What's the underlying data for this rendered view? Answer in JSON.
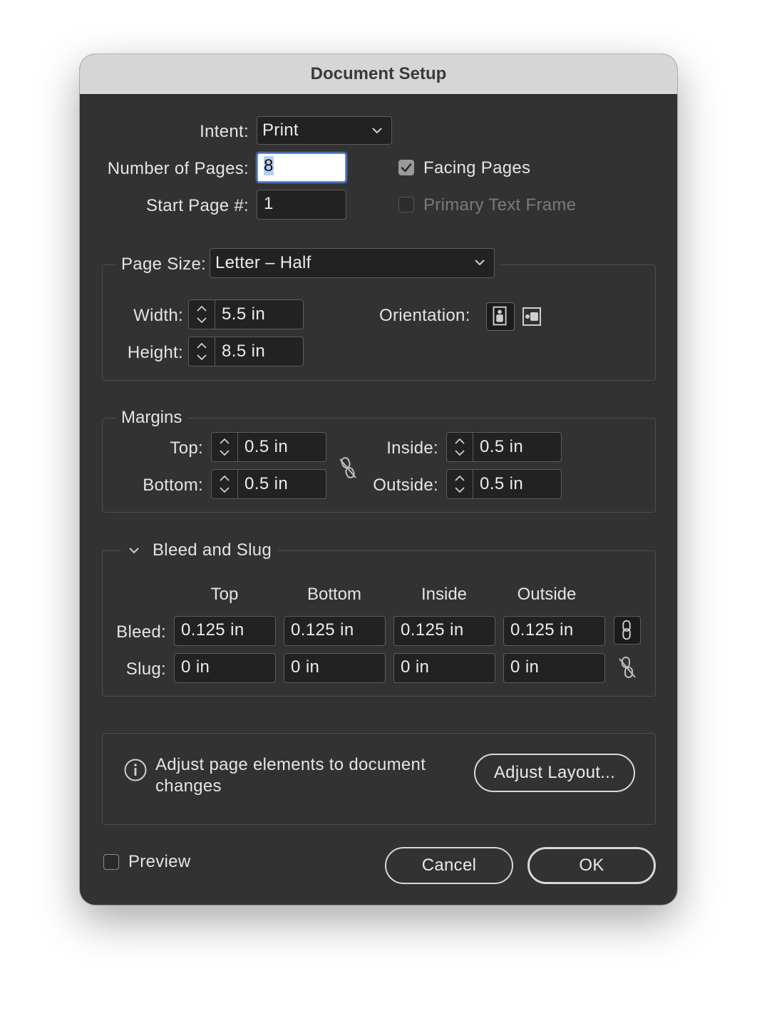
{
  "window": {
    "title": "Document Setup"
  },
  "intent": {
    "label": "Intent:",
    "value": "Print"
  },
  "pages": {
    "number_label": "Number of Pages:",
    "number_value": "8",
    "start_label": "Start Page #:",
    "start_value": "1",
    "facing_label": "Facing Pages",
    "facing_checked": true,
    "primary_label": "Primary Text Frame",
    "primary_checked": false
  },
  "page_size": {
    "label": "Page Size:",
    "value": "Letter – Half",
    "width_label": "Width:",
    "width_value": "5.5 in",
    "height_label": "Height:",
    "height_value": "8.5 in",
    "orientation_label": "Orientation:",
    "orientation": "portrait"
  },
  "margins": {
    "legend": "Margins",
    "top_label": "Top:",
    "top_value": "0.5 in",
    "bottom_label": "Bottom:",
    "bottom_value": "0.5 in",
    "inside_label": "Inside:",
    "inside_value": "0.5 in",
    "outside_label": "Outside:",
    "outside_value": "0.5 in"
  },
  "bleed_slug": {
    "legend": "Bleed and Slug",
    "columns": [
      "Top",
      "Bottom",
      "Inside",
      "Outside"
    ],
    "bleed_label": "Bleed:",
    "bleed_values": [
      "0.125 in",
      "0.125 in",
      "0.125 in",
      "0.125 in"
    ],
    "slug_label": "Slug:",
    "slug_values": [
      "0 in",
      "0 in",
      "0 in",
      "0 in"
    ]
  },
  "adjust": {
    "text_line1": "Adjust page elements to document",
    "text_line2": "changes",
    "button": "Adjust Layout..."
  },
  "footer": {
    "preview_label": "Preview",
    "cancel": "Cancel",
    "ok": "OK"
  },
  "colors": {
    "dialog_bg": "#323232",
    "title_bg": "#d6d6d6",
    "focus": "#4f8ff7"
  },
  "icons": [
    "chevron-down-icon",
    "stepper-icon",
    "portrait-icon",
    "landscape-icon",
    "unlink-icon",
    "link-icon",
    "info-icon",
    "checkmark-icon"
  ]
}
